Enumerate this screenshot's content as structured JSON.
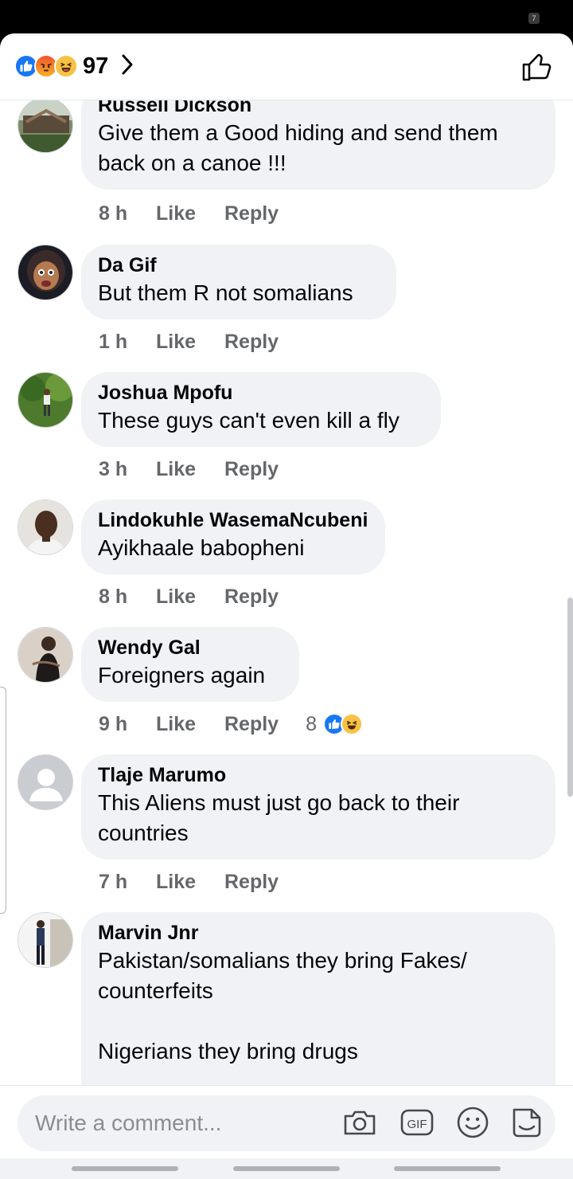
{
  "status_bar": {
    "badge": "7"
  },
  "header": {
    "reaction_icons": [
      "like-reaction-icon",
      "angry-reaction-icon",
      "haha-reaction-icon"
    ],
    "reaction_count": "97",
    "chevron_icon": "chevron-right-icon",
    "like_icon": "thumbs-up-icon"
  },
  "comments": [
    {
      "author": "Russell Dickson",
      "text": "Give them a Good hiding and send them\nback on a canoe !!!",
      "time": "8 h",
      "like": "Like",
      "reply": "Reply",
      "avatar": "landscape-photo"
    },
    {
      "author": "Da Gif",
      "text": "But them R not somalians",
      "time": "1 h",
      "like": "Like",
      "reply": "Reply",
      "avatar": "portrait-photo"
    },
    {
      "author": "Joshua Mpofu",
      "text": "These guys can't even kill a fly",
      "time": "3 h",
      "like": "Like",
      "reply": "Reply",
      "avatar": "outdoor-photo"
    },
    {
      "author": "Lindokuhle WasemaNcubeni",
      "text": "Ayikhaale babopheni",
      "time": "8 h",
      "like": "Like",
      "reply": "Reply",
      "avatar": "portrait-photo"
    },
    {
      "author": "Wendy Gal",
      "text": "Foreigners again",
      "time": "9 h",
      "like": "Like",
      "reply": "Reply",
      "reaction_count": "8",
      "reactions": [
        "like-reaction-icon",
        "haha-reaction-icon"
      ],
      "avatar": "portrait-photo"
    },
    {
      "author": "Tlaje Marumo",
      "text": "This Aliens must just go back to their\ncountries",
      "time": "7 h",
      "like": "Like",
      "reply": "Reply",
      "avatar": "default-avatar"
    },
    {
      "author": "Marvin Jnr",
      "text": "Pakistan/somalians they bring Fakes/\ncounterfeits\n\nNigerians they bring drugs",
      "avatar": "full-body-photo"
    }
  ],
  "composer": {
    "placeholder": "Write a comment...",
    "icons": [
      "camera-icon",
      "gif-icon",
      "emoji-icon",
      "sticker-icon"
    ],
    "gif_label": "GIF"
  },
  "colors": {
    "like_blue": "#1877f2",
    "bubble_bg": "#f0f2f5",
    "meta_gray": "#65676b",
    "text": "#050505"
  }
}
